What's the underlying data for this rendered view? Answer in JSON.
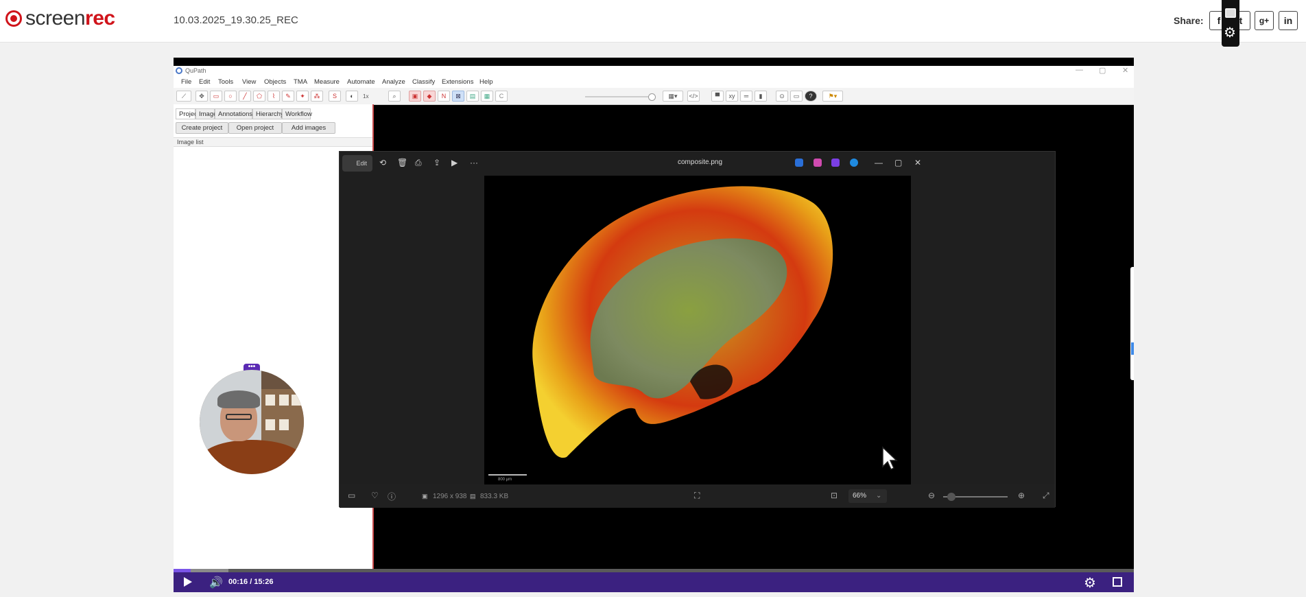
{
  "header": {
    "logo_a": "screen",
    "logo_b": "rec",
    "recording_title": "10.03.2025_19.30.25_REC",
    "share_label": "Share:",
    "share_buttons": [
      "f",
      "t",
      "g+",
      "in"
    ]
  },
  "qupath": {
    "window_title": "QuPath",
    "menu": [
      "File",
      "Edit",
      "Tools",
      "View",
      "Objects",
      "TMA",
      "Measure",
      "Automate",
      "Analyze",
      "Classify",
      "Extensions",
      "Help"
    ],
    "toolbar_zoom": "1x",
    "tabs": [
      "Project",
      "Image",
      "Annotations",
      "Hierarchy",
      "Workflow"
    ],
    "buttons": {
      "create": "Create project",
      "open": "Open project",
      "add": "Add images"
    },
    "image_list_label": "Image list",
    "webcam_menu": "•••"
  },
  "viewer": {
    "edit_label": "Edit",
    "filename": "composite.png",
    "dimensions": "1296 x 938",
    "filesize": "833.3 KB",
    "zoom": "66%",
    "scalebar_label": "800 µm"
  },
  "player": {
    "time": "00:16 / 15:26",
    "progress": 0.018
  },
  "colors": {
    "brand_red": "#d0141b",
    "player_bar": "#3b2180",
    "progress_played": "#7a55e8"
  }
}
